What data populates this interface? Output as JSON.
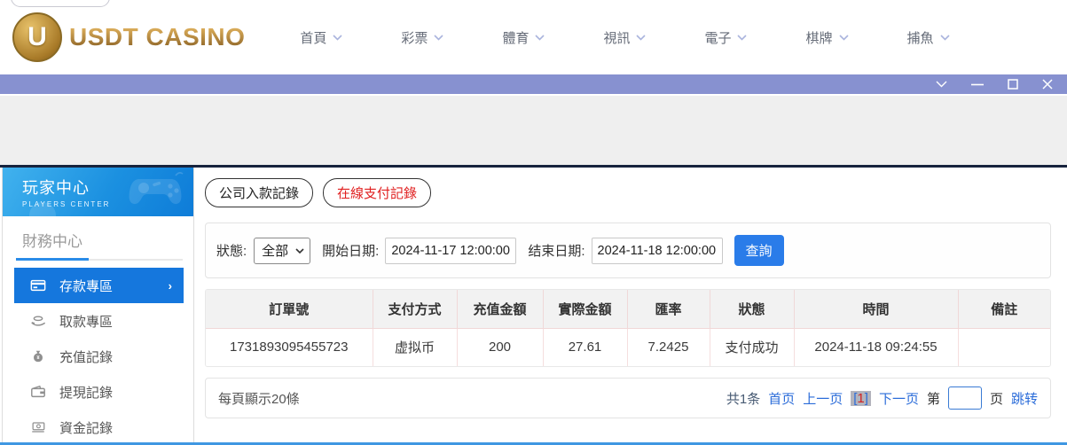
{
  "header": {
    "logo_letter": "U",
    "logo_text": "USDT CASINO",
    "nav": [
      {
        "label": "首頁"
      },
      {
        "label": "彩票"
      },
      {
        "label": "體育"
      },
      {
        "label": "視訊"
      },
      {
        "label": "電子"
      },
      {
        "label": "棋牌"
      },
      {
        "label": "捕魚"
      }
    ]
  },
  "sidebar": {
    "title": "玩家中心",
    "subtitle": "PLAYERS CENTER",
    "section_title": "財務中心",
    "items": [
      {
        "label": "存款專區",
        "icon": "deposit-card-icon",
        "active": true
      },
      {
        "label": "取款專區",
        "icon": "withdraw-hand-icon",
        "active": false
      },
      {
        "label": "充值記錄",
        "icon": "money-bag-icon",
        "active": false
      },
      {
        "label": "提現記錄",
        "icon": "wallet-icon",
        "active": false
      },
      {
        "label": "資金記錄",
        "icon": "banknote-icon",
        "active": false
      }
    ],
    "active_arrow": "›"
  },
  "main": {
    "tabs": [
      {
        "label": "公司入款記錄",
        "active": false
      },
      {
        "label": "在線支付記錄",
        "active": true
      }
    ],
    "filters": {
      "status_label": "狀態:",
      "status_value": "全部",
      "start_label": "開始日期:",
      "start_value": "2024-11-17 12:00:00",
      "end_label": "结束日期:",
      "end_value": "2024-11-18 12:00:00",
      "search_label": "查詢"
    },
    "table": {
      "headers": [
        "訂單號",
        "支付方式",
        "充值金額",
        "實際金額",
        "匯率",
        "狀態",
        "時間",
        "備註"
      ],
      "rows": [
        [
          "1731893095455723",
          "虚拟币",
          "200",
          "27.61",
          "7.2425",
          "支付成功",
          "2024-11-18 09:24:55",
          ""
        ]
      ]
    },
    "pagination": {
      "page_size_text": "每頁顯示20條",
      "total_text": "共1条",
      "first_label": "首页",
      "prev_label": "上一页",
      "bracket_open": "[",
      "current_page": "1",
      "bracket_close": "]",
      "next_label": "下一页",
      "jump_prefix": "第",
      "jump_value": "",
      "jump_suffix": "页",
      "jump_label": "跳转"
    }
  },
  "colors": {
    "titlebar_purple": "#8791d0",
    "sidebar_header_blue_start": "#41b2ee",
    "sidebar_header_blue_end": "#0e7cd8",
    "active_menu_blue": "#1577dd",
    "search_button_blue": "#2a7ce9",
    "link_blue": "#2b6cd9",
    "tab_active_red": "#e02020",
    "table_border_pink": "#f0d8d8",
    "dark_top_border": "#17233d",
    "gray_band": "#efefef",
    "gold_logo": "#b9914f"
  }
}
